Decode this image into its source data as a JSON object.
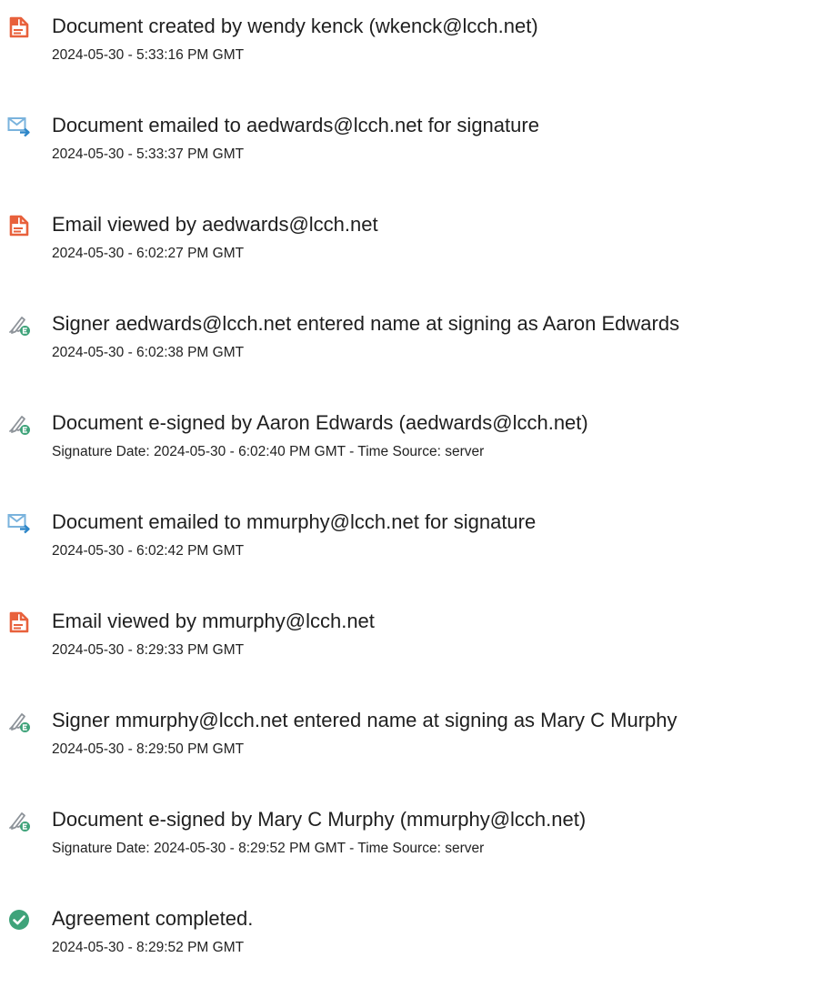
{
  "colors": {
    "document_icon": "#e8613c",
    "email_icon": "#2d86c8",
    "sign_icon": "#3fa37a",
    "check_icon": "#3fa37a"
  },
  "events": [
    {
      "icon": "document-icon",
      "title": "Document created by wendy kenck (wkenck@lcch.net)",
      "detail": "2024-05-30 - 5:33:16 PM GMT"
    },
    {
      "icon": "email-sent-icon",
      "title": "Document emailed to aedwards@lcch.net for signature",
      "detail": "2024-05-30 - 5:33:37 PM GMT"
    },
    {
      "icon": "document-icon",
      "title": "Email viewed by aedwards@lcch.net",
      "detail": "2024-05-30 - 6:02:27 PM GMT"
    },
    {
      "icon": "e-sign-pen-icon",
      "title": "Signer aedwards@lcch.net entered name at signing as Aaron Edwards",
      "detail": "2024-05-30 - 6:02:38 PM GMT"
    },
    {
      "icon": "e-sign-pen-icon",
      "title": "Document e-signed by Aaron Edwards (aedwards@lcch.net)",
      "detail": "Signature Date: 2024-05-30 - 6:02:40 PM GMT - Time Source: server"
    },
    {
      "icon": "email-sent-icon",
      "title": "Document emailed to mmurphy@lcch.net for signature",
      "detail": "2024-05-30 - 6:02:42 PM GMT"
    },
    {
      "icon": "document-icon",
      "title": "Email viewed by mmurphy@lcch.net",
      "detail": "2024-05-30 - 8:29:33 PM GMT"
    },
    {
      "icon": "e-sign-pen-icon",
      "title": "Signer mmurphy@lcch.net entered name at signing as Mary C Murphy",
      "detail": "2024-05-30 - 8:29:50 PM GMT"
    },
    {
      "icon": "e-sign-pen-icon",
      "title": "Document e-signed by Mary C Murphy (mmurphy@lcch.net)",
      "detail": "Signature Date: 2024-05-30 - 8:29:52 PM GMT - Time Source: server"
    },
    {
      "icon": "check-circle-icon",
      "title": "Agreement completed.",
      "detail": "2024-05-30 - 8:29:52 PM GMT"
    }
  ]
}
